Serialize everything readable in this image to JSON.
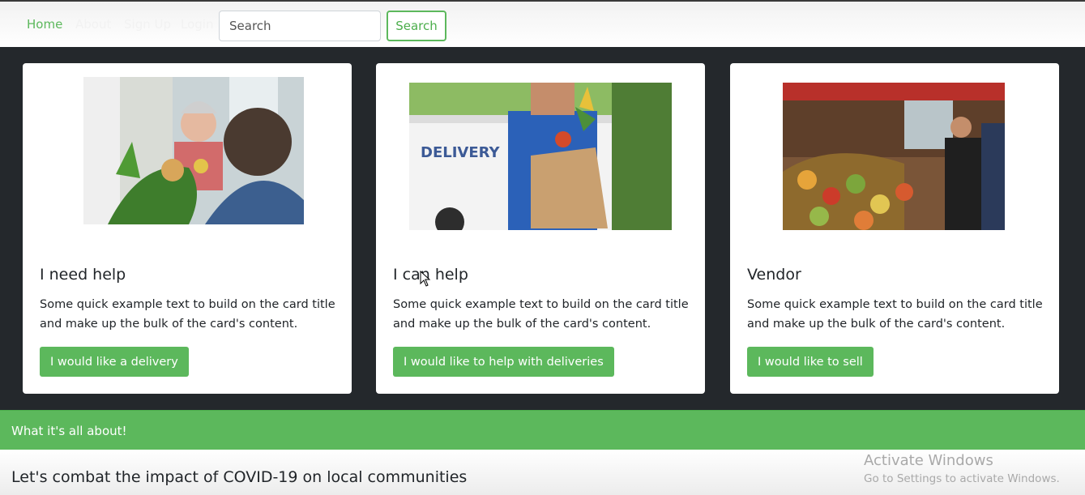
{
  "nav": {
    "links": [
      {
        "label": "Home",
        "active": true
      },
      {
        "label": "About",
        "active": false
      },
      {
        "label": "Sign Up",
        "active": false
      },
      {
        "label": "Login",
        "active": false
      }
    ],
    "search_placeholder": "Search",
    "search_button": "Search"
  },
  "cards": [
    {
      "title": "I need help",
      "text": "Some quick example text to build on the card title and make up the bulk of the card's content.",
      "button": "I would like a delivery",
      "image_icon": "delivery-to-elderly-photo"
    },
    {
      "title": "I can help",
      "text": "Some quick example text to build on the card title and make up the bulk of the card's content.",
      "button": "I would like to help with deliveries",
      "image_icon": "delivery-person-photo",
      "image_text": "DELIVERY"
    },
    {
      "title": "Vendor",
      "text": "Some quick example text to build on the card title and make up the bulk of the card's content.",
      "button": "I would like to sell",
      "image_icon": "market-vendor-photo"
    }
  ],
  "banner": {
    "text": "What it's all about!"
  },
  "section": {
    "heading": "Let's combat the impact of COVID-19 on local communities"
  },
  "watermark": {
    "title": "Activate Windows",
    "subtitle": "Go to Settings to activate Windows."
  },
  "colors": {
    "accent": "#5cb85c",
    "dark_bg": "#24282c",
    "card_bg": "#ffffff"
  }
}
